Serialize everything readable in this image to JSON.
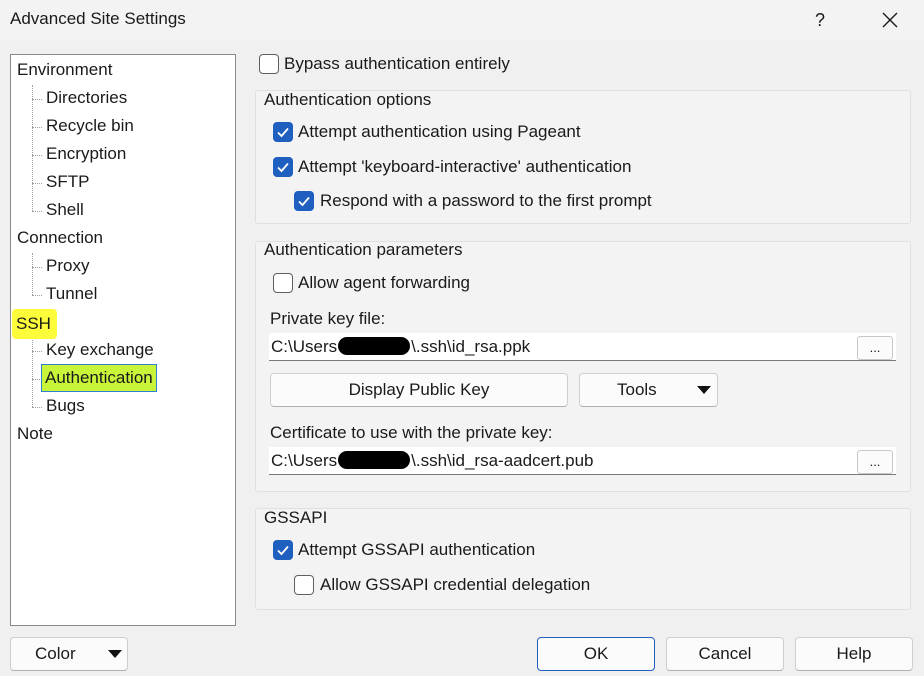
{
  "window": {
    "title": "Advanced Site Settings",
    "help_glyph": "?"
  },
  "tree": {
    "environment": "Environment",
    "directories": "Directories",
    "recycle_bin": "Recycle bin",
    "encryption": "Encryption",
    "sftp": "SFTP",
    "shell": "Shell",
    "connection": "Connection",
    "proxy": "Proxy",
    "tunnel": "Tunnel",
    "ssh": "SSH",
    "key_exchange": "Key exchange",
    "authentication": "Authentication",
    "bugs": "Bugs",
    "note": "Note",
    "selected": "Authentication",
    "highlight_color": "#fdfc3a",
    "selected_color": "#c8f53a"
  },
  "bypass": {
    "label": "Bypass authentication entirely",
    "checked": false
  },
  "auth_options": {
    "title": "Authentication options",
    "pageant": {
      "label": "Attempt authentication using Pageant",
      "checked": true
    },
    "keyboard_interactive": {
      "label": "Attempt 'keyboard-interactive' authentication",
      "checked": true
    },
    "respond_password": {
      "label": "Respond with a password to the first prompt",
      "checked": true
    }
  },
  "auth_params": {
    "title": "Authentication parameters",
    "agent_forwarding": {
      "label": "Allow agent forwarding",
      "checked": false
    },
    "private_key_label": "Private key file:",
    "private_key_prefix": "C:\\Users",
    "private_key_suffix": "\\.ssh\\id_rsa.ppk",
    "browse": "...",
    "display_public_key": "Display Public Key",
    "tools": "Tools",
    "certificate_label": "Certificate to use with the private key:",
    "certificate_prefix": "C:\\Users",
    "certificate_suffix": "\\.ssh\\id_rsa-aadcert.pub"
  },
  "gssapi": {
    "title": "GSSAPI",
    "attempt": {
      "label": "Attempt GSSAPI authentication",
      "checked": true
    },
    "delegation": {
      "label": "Allow GSSAPI credential delegation",
      "checked": false
    }
  },
  "footer": {
    "color": "Color",
    "ok": "OK",
    "cancel": "Cancel",
    "help": "Help"
  },
  "colors": {
    "accent": "#1f5fbf"
  }
}
